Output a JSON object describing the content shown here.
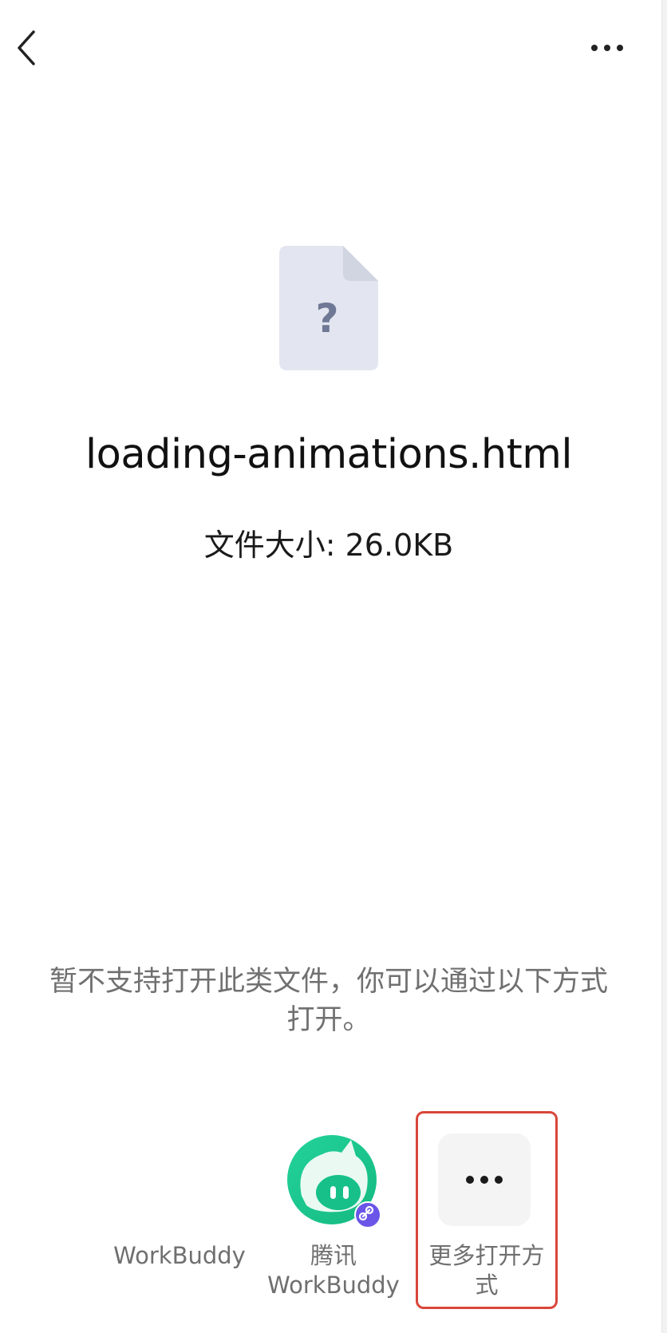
{
  "header": {
    "back_icon": "chevron-left-icon",
    "more_icon": "more-horizontal-icon"
  },
  "file": {
    "icon": "unknown-file-icon",
    "icon_glyph": "?",
    "name": "loading-animations.html",
    "size_text": "文件大小: 26.0KB"
  },
  "notice": {
    "text": "暂不支持打开此类文件，你可以通过以下方式打开。"
  },
  "apps": [
    {
      "label": "WorkBuddy",
      "icon": ""
    },
    {
      "label": "腾讯\nWorkBuddy",
      "label_line1": "腾讯",
      "label_line2": "WorkBuddy",
      "icon": "workbuddy-mascot-icon",
      "badge_icon": "mini-program-link-icon"
    },
    {
      "label_line1": "更多打开方",
      "label_line2": "式",
      "icon": "more-horizontal-icon"
    }
  ],
  "colors": {
    "file_icon_bg": "#e3e6f0",
    "file_icon_fold": "#d1d5e2",
    "file_icon_glyph": "#6f7894",
    "highlight_border": "#d9463a",
    "brand_green": "#1fcf94",
    "badge_purple": "#6a55e8"
  }
}
